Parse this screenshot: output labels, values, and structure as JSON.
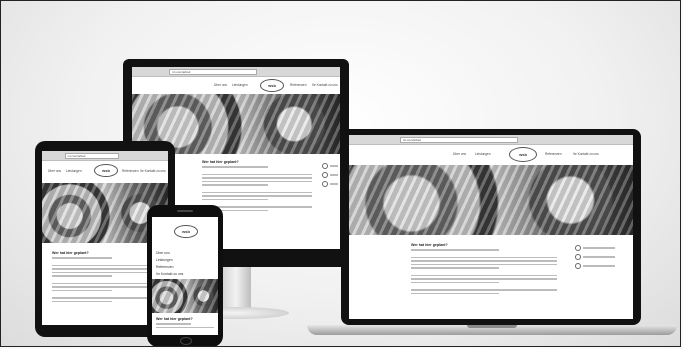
{
  "logo_text": "wsb",
  "browser_url": "ivt.com/arbeit",
  "nav": {
    "left_1": "Über uns",
    "left_2": "Leistungen",
    "right_1": "Referenzen",
    "right_2": "Ihr Kontakt zu uns"
  },
  "page": {
    "heading": "Wer hat hier geplant?"
  },
  "phone_menu": [
    "Über uns",
    "Leistungen",
    "Referenzen",
    "Ihr Kontakt zu uns"
  ],
  "icons": [
    "phone-icon",
    "location-icon",
    "mail-icon"
  ]
}
